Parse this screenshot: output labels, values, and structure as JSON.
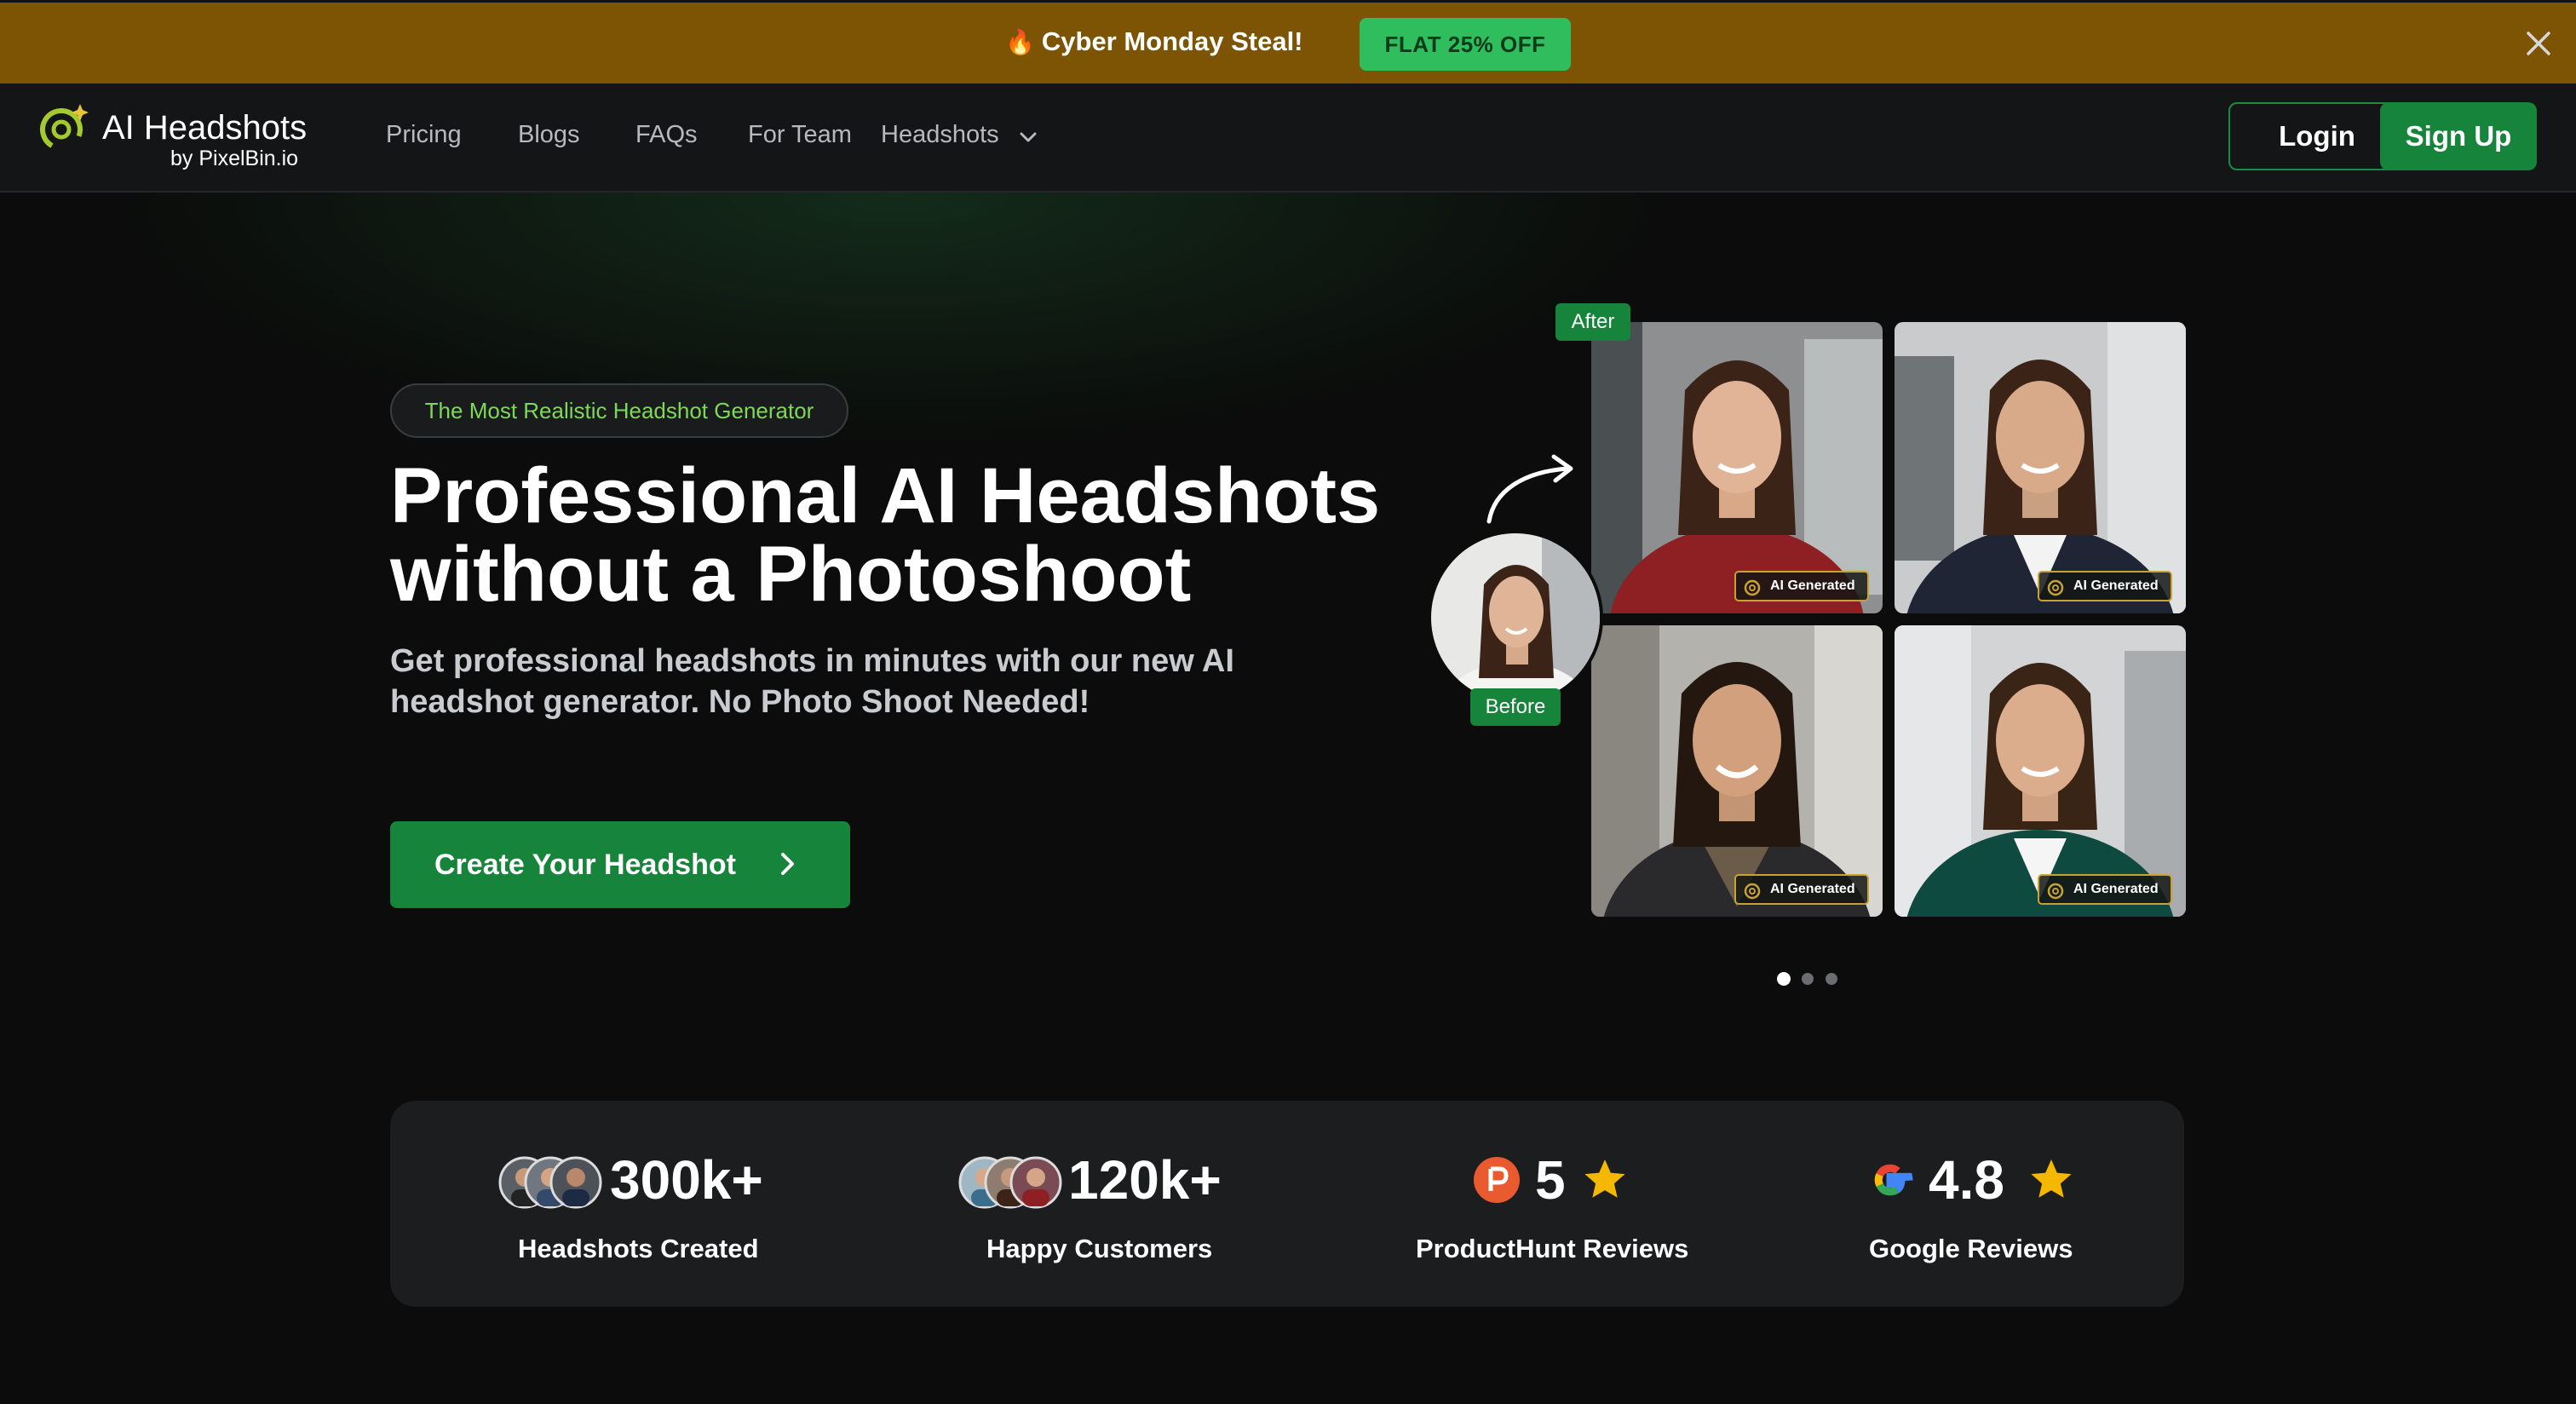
{
  "promo": {
    "text": "Cyber Monday Steal!",
    "button_label": "FLAT 25% OFF"
  },
  "nav": {
    "logo_title": "AI Headshots",
    "logo_by": "by",
    "logo_sub": "PixelBin.io",
    "links": [
      "Pricing",
      "Blogs",
      "FAQs",
      "For Team",
      "Headshots"
    ],
    "login_label": "Login",
    "signup_label": "Sign Up"
  },
  "hero": {
    "tagline": "The Most Realistic Headshot Generator",
    "title": "Professional AI Headshots without a Photoshoot",
    "subtitle": "Get professional headshots in minutes with our new AI headshot generator. No Photo Shoot Needed!",
    "cta_label": "Create Your Headshot",
    "after_label": "After",
    "before_label": "Before",
    "ai_badge_label": "AI Generated",
    "carousel": {
      "count": 3,
      "active_index": 0
    }
  },
  "stats": [
    {
      "value": "300k+",
      "label": "Headshots Created"
    },
    {
      "value": "120k+",
      "label": "Happy Customers"
    },
    {
      "value": "5",
      "label": "ProductHunt Reviews"
    },
    {
      "value": "4.8",
      "label": "Google Reviews"
    }
  ],
  "colors": {
    "promo_bg": "#7c5404",
    "accent_green": "#16843a",
    "promo_button": "#2fbd5e",
    "tagline_text": "#7ed957",
    "star": "#f5b800"
  }
}
